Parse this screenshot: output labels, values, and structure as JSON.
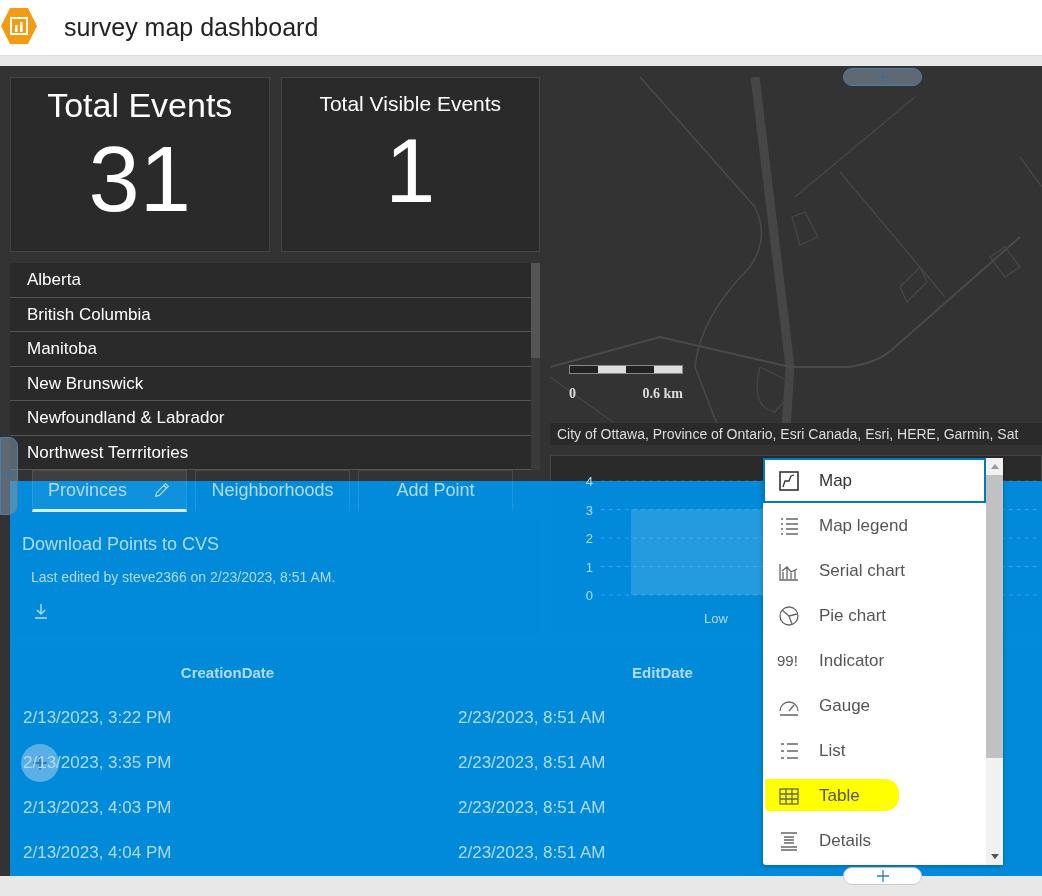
{
  "app": {
    "title": "survey map dashboard"
  },
  "indicators": [
    {
      "title": "Total Events",
      "value": "31"
    },
    {
      "title": "Total Visible Events",
      "value": "1"
    }
  ],
  "province_list": {
    "items": [
      "Alberta",
      "British Columbia",
      "Manitoba",
      "New Brunswick",
      "Newfoundland & Labrador",
      "Northwest Terrritories"
    ]
  },
  "tabs": [
    {
      "label": "Provinces",
      "selected": true,
      "editable": true
    },
    {
      "label": "Neighborhoods",
      "selected": false,
      "editable": false
    },
    {
      "label": "Add Point",
      "selected": false,
      "editable": false
    }
  ],
  "details": {
    "title": "Download Points to CVS",
    "note": "Last edited by steve2366 on 2/23/2023, 8:51 AM."
  },
  "map": {
    "scale_start": "0",
    "scale_end": "0.6 km",
    "attribution": "City of Ottawa, Province of Ontario, Esri Canada, Esri, HERE, Garmin, Sat"
  },
  "chart": {
    "chart_data": {
      "type": "bar",
      "categories": [
        "Low"
      ],
      "values": [
        3
      ],
      "yticks": [
        0,
        1,
        2,
        3,
        4
      ],
      "ylim": [
        0,
        4
      ],
      "grid": true
    }
  },
  "table": {
    "columns": [
      "CreationDate",
      "EditDate"
    ],
    "rows": [
      [
        "2/13/2023, 3:22 PM",
        "2/23/2023, 8:51 AM"
      ],
      [
        "2/13/2023, 3:35 PM",
        "2/23/2023, 8:51 AM"
      ],
      [
        "2/13/2023, 4:03 PM",
        "2/23/2023, 8:51 AM"
      ],
      [
        "2/13/2023, 4:04 PM",
        "2/23/2023, 8:51 AM"
      ]
    ]
  },
  "widget_menu": {
    "items": [
      {
        "kind": "map",
        "label": "Map",
        "selected": true,
        "highlighted": false
      },
      {
        "kind": "legend",
        "label": "Map legend",
        "selected": false,
        "highlighted": false
      },
      {
        "kind": "serial",
        "label": "Serial chart",
        "selected": false,
        "highlighted": false
      },
      {
        "kind": "pie",
        "label": "Pie chart",
        "selected": false,
        "highlighted": false
      },
      {
        "kind": "indicator",
        "label": "Indicator",
        "icon_text": "99!",
        "selected": false,
        "highlighted": false
      },
      {
        "kind": "gauge",
        "label": "Gauge",
        "selected": false,
        "highlighted": false
      },
      {
        "kind": "list",
        "label": "List",
        "selected": false,
        "highlighted": false
      },
      {
        "kind": "table",
        "label": "Table",
        "selected": false,
        "highlighted": true
      },
      {
        "kind": "details",
        "label": "Details",
        "selected": false,
        "highlighted": false
      }
    ]
  }
}
